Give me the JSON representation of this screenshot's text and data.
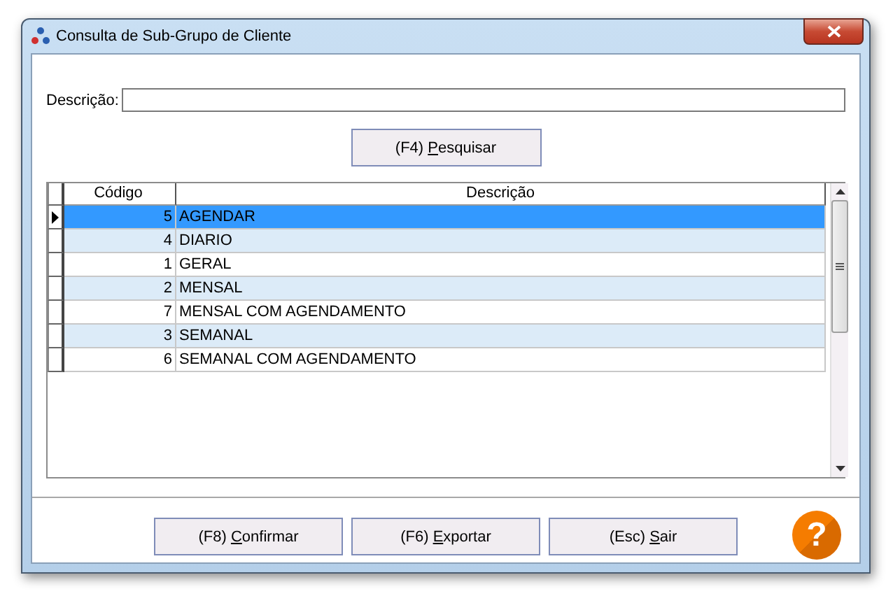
{
  "window": {
    "title": "Consulta de Sub-Grupo de Cliente"
  },
  "search": {
    "label": "Descrição:"
  },
  "search_button": {
    "shortcut": "(F4)",
    "accesskey": "P",
    "rest": "esquisar"
  },
  "table": {
    "columns": [
      "Código",
      "Descrição"
    ],
    "rows": [
      {
        "code": "5",
        "description": "AGENDAR",
        "selected": true
      },
      {
        "code": "4",
        "description": "DIARIO",
        "selected": false
      },
      {
        "code": "1",
        "description": "GERAL",
        "selected": false
      },
      {
        "code": "2",
        "description": "MENSAL",
        "selected": false
      },
      {
        "code": "7",
        "description": "MENSAL COM AGENDAMENTO",
        "selected": false
      },
      {
        "code": "3",
        "description": "SEMANAL",
        "selected": false
      },
      {
        "code": "6",
        "description": "SEMANAL COM AGENDAMENTO",
        "selected": false
      }
    ]
  },
  "buttons": [
    {
      "shortcut": "(F8)",
      "accesskey": "C",
      "rest": "onfirmar"
    },
    {
      "shortcut": "(F6)",
      "accesskey": "E",
      "rest": "xportar"
    },
    {
      "shortcut": "(Esc)",
      "accesskey": "S",
      "rest": "air"
    }
  ],
  "help": {
    "label": "?"
  }
}
